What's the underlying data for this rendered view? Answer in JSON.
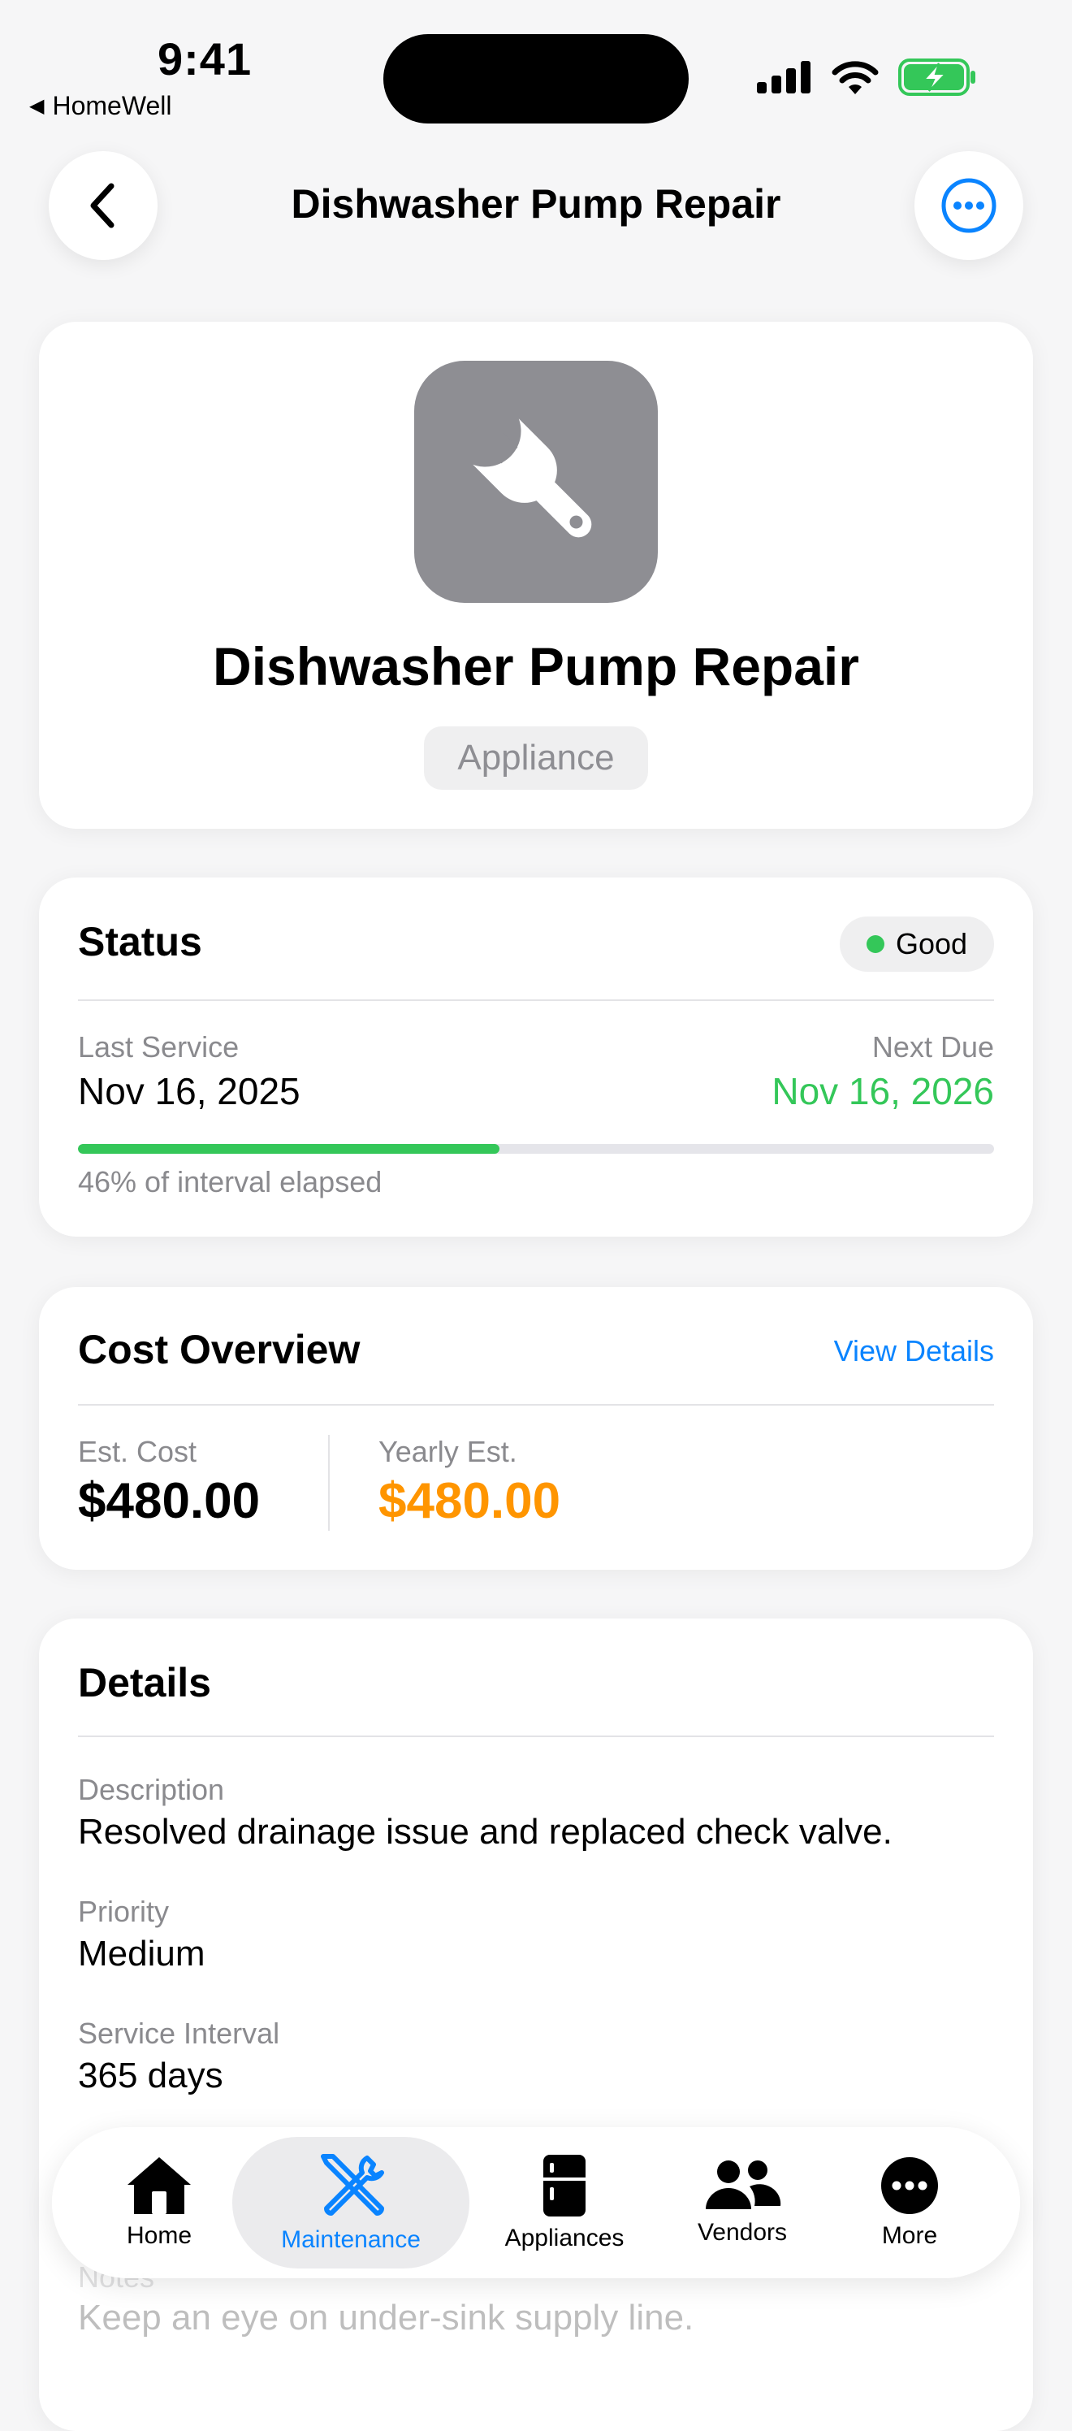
{
  "status_bar": {
    "time": "9:41",
    "back_app": "HomeWell"
  },
  "nav": {
    "title": "Dishwasher Pump Repair"
  },
  "hero": {
    "title": "Dishwasher Pump Repair",
    "tag": "Appliance"
  },
  "status": {
    "heading": "Status",
    "badge": "Good",
    "last_label": "Last Service",
    "last_value": "Nov 16, 2025",
    "next_label": "Next Due",
    "next_value": "Nov 16, 2026",
    "progress_fraction": 0.46,
    "progress_label": "46% of interval elapsed"
  },
  "cost": {
    "heading": "Cost Overview",
    "link": "View Details",
    "est_label": "Est. Cost",
    "est_value": "$480.00",
    "yearly_label": "Yearly Est.",
    "yearly_value": "$480.00"
  },
  "details": {
    "heading": "Details",
    "description_label": "Description",
    "description_value": "Resolved drainage issue and replaced check valve.",
    "priority_label": "Priority",
    "priority_value": "Medium",
    "interval_label": "Service Interval",
    "interval_value": "365 days",
    "notes_label": "Notes",
    "notes_value": "Keep an eye on under-sink supply line."
  },
  "tabs": [
    {
      "label": "Home",
      "icon": "house-icon"
    },
    {
      "label": "Maintenance",
      "icon": "tools-icon",
      "active": true
    },
    {
      "label": "Appliances",
      "icon": "refrigerator-icon"
    },
    {
      "label": "Vendors",
      "icon": "people-icon"
    },
    {
      "label": "More",
      "icon": "ellipsis-circle-icon"
    }
  ],
  "colors": {
    "accent": "#0a84ff",
    "good": "#34c759",
    "orange": "#ff9500",
    "gray_icon": "#8e8e93"
  }
}
